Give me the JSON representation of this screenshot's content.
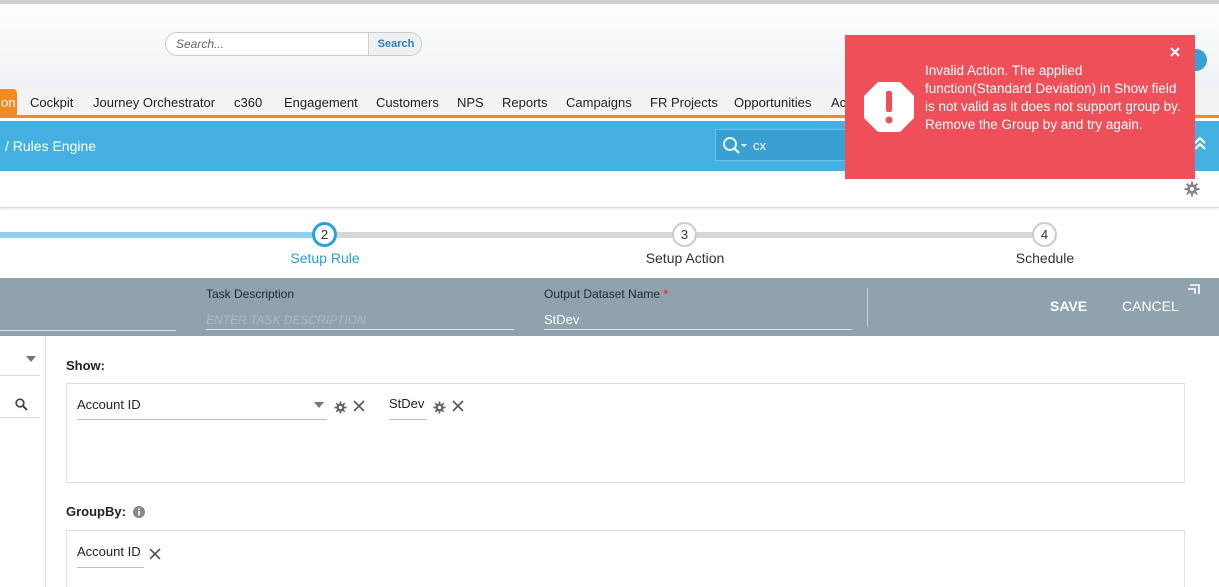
{
  "header": {
    "search_placeholder": "Search...",
    "search_button": "Search"
  },
  "nav": {
    "active_partial": "on",
    "items": [
      "Cockpit",
      "Journey Orchestrator",
      "c360",
      "Engagement",
      "Customers",
      "NPS",
      "Reports",
      "Campaigns",
      "FR Projects",
      "Opportunities",
      "Ac"
    ]
  },
  "bluebar": {
    "breadcrumb": "/ Rules Engine",
    "search_value": "cx"
  },
  "steps": [
    {
      "number": "2",
      "label": "Setup Rule",
      "state": "active"
    },
    {
      "number": "3",
      "label": "Setup Action",
      "state": "pending"
    },
    {
      "number": "4",
      "label": "Schedule",
      "state": "pending"
    }
  ],
  "form": {
    "task_description_label": "Task Description",
    "task_description_placeholder": "ENTER TASK DESCRIPTION",
    "output_dataset_label": "Output Dataset Name",
    "required_mark": "*",
    "output_dataset_value": "StDev",
    "save": "SAVE",
    "cancel": "CANCEL"
  },
  "show": {
    "title": "Show:",
    "field_select": "Account ID",
    "measure": "StDev"
  },
  "groupby": {
    "title": "GroupBy:",
    "field": "Account ID"
  },
  "toast": {
    "message": "Invalid Action. The applied function(Standard Deviation) in Show field is not valid as it does not support group by. Remove the Group by and try again."
  },
  "colors": {
    "accent_orange": "#f08a24",
    "header_blue": "#45b1e2",
    "form_bar": "#8fa2ad",
    "error_red": "#ef4f59",
    "step_active": "#2b9fd9"
  }
}
